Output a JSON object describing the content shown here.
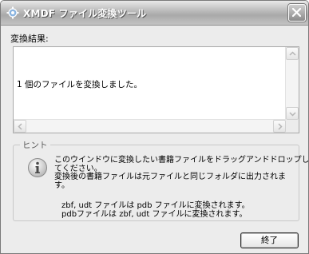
{
  "window": {
    "title": "XMDF ファイル変換ツール",
    "title_icon": "gear-icon",
    "close_icon": "close-icon"
  },
  "result": {
    "label": "変換結果:",
    "text": "1 個のファイルを変換しました。"
  },
  "hint": {
    "legend": "ヒント",
    "icon": "info-icon",
    "lines": [
      "このウインドウに変換したい書籍ファイルをドラッグアンドドロップし",
      "てください。",
      "変換後の書籍ファイルは元ファイルと同じフォルダに出力されま",
      "す。"
    ],
    "note_lines": [
      "zbf, udt ファイルは pdb ファイルに変換されます。",
      "pdbファイルは zbf, udt ファイルに変換されます。"
    ]
  },
  "buttons": {
    "end_label": "終了"
  }
}
